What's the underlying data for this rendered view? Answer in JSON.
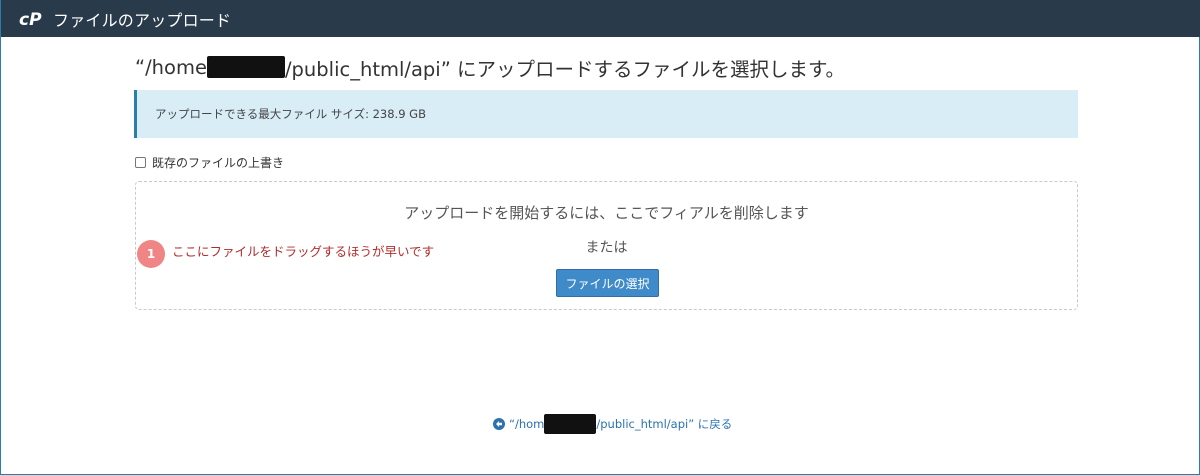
{
  "header": {
    "title": "ファイルのアップロード",
    "logo_icon": "cpanel-logo-icon"
  },
  "heading": {
    "prefix": "“/home",
    "suffix": "/public_html/api” にアップロードするファイルを選択します。"
  },
  "info": {
    "text": "アップロードできる最大ファイル サイズ: 238.9 GB"
  },
  "overwrite": {
    "label": "既存のファイルの上書き",
    "checked": false
  },
  "dropzone": {
    "instruction": "アップロードを開始するには、ここでフィアルを削除します",
    "or_text": "または",
    "select_button": "ファイルの選択"
  },
  "annotation": {
    "number": "1",
    "text": "ここにファイルをドラッグするほうが早いです"
  },
  "back_link": {
    "icon": "arrow-left-circle-icon",
    "prefix": "“/hom",
    "suffix": "/public_html/api” に戻る"
  },
  "colors": {
    "topbar": "#293a4a",
    "info_bg": "#d9edf7",
    "button": "#3f8bc9",
    "annotation": "#f08585",
    "link": "#2a72b0"
  }
}
